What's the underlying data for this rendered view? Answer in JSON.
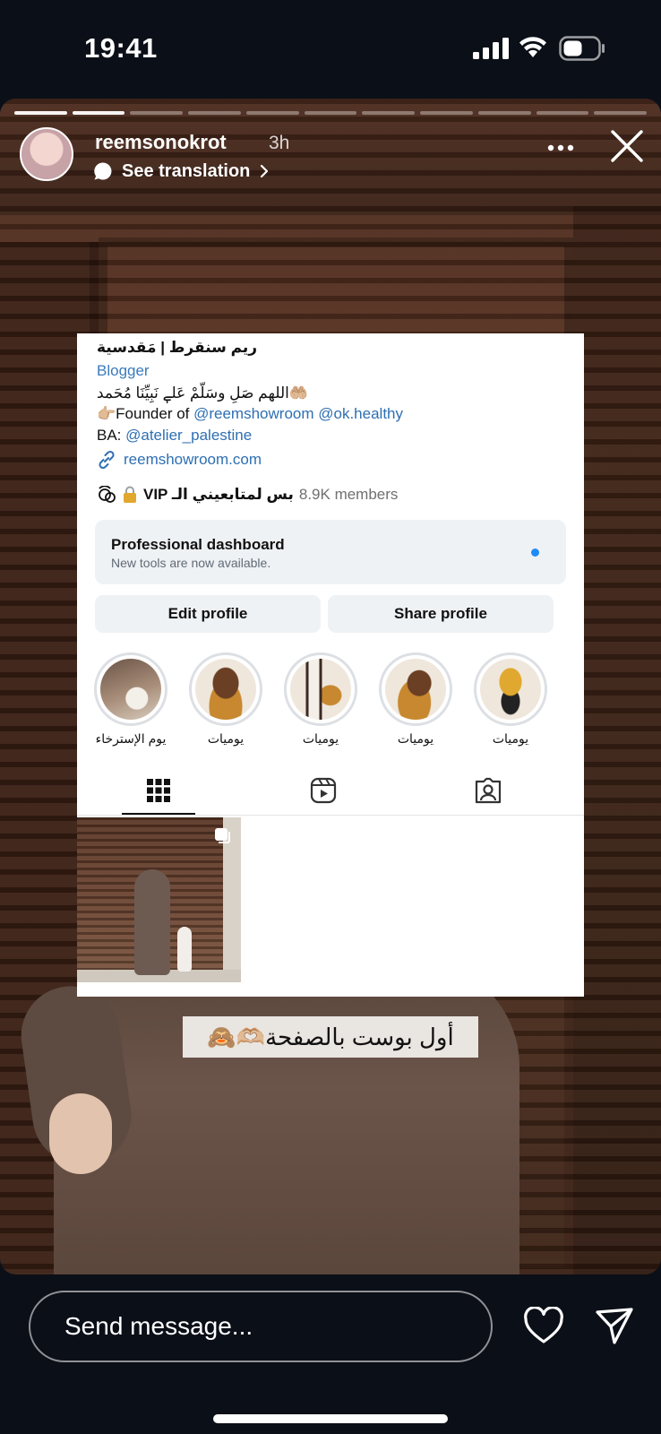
{
  "status_bar": {
    "time": "19:41"
  },
  "story": {
    "progress_total": 11,
    "progress_done": 2,
    "username": "reemsonokrot",
    "time_ago": "3h",
    "translate_label": "See translation",
    "caption": "أول بوست بالصفحة🫶🏼🙈"
  },
  "profile": {
    "name": "ريم سنقرط | مَقدسية",
    "category": "Blogger",
    "bio_line1": "اللهم صَلِ وسَلّمْ عَلےٖ نَبِيِّنَا مُحَمد🤲🏼",
    "bio_line2_prefix": "👉🏼Founder of ",
    "bio_link_1": "@reemshowroom",
    "bio_link_2": "@ok.healthy",
    "bio_line3_prefix": "BA: ",
    "bio_link_3": "@atelier_palestine",
    "website": "reemshowroom.com",
    "channel_name": "VIP بس لمتابعيني الـ",
    "channel_members": "8.9K members",
    "dashboard_title": "Professional dashboard",
    "dashboard_subtitle": "New tools are now available.",
    "edit_profile": "Edit profile",
    "share_profile": "Share profile",
    "highlights": [
      {
        "label": "يوم الإسترخاء"
      },
      {
        "label": "يوميات"
      },
      {
        "label": "يوميات"
      },
      {
        "label": "يوميات"
      },
      {
        "label": "يوميات"
      }
    ]
  },
  "composer": {
    "placeholder": "Send message..."
  },
  "colors": {
    "link": "#2e6fb2",
    "notification_dot": "#1d8cf8",
    "story_bg": "#4b2a1c"
  }
}
